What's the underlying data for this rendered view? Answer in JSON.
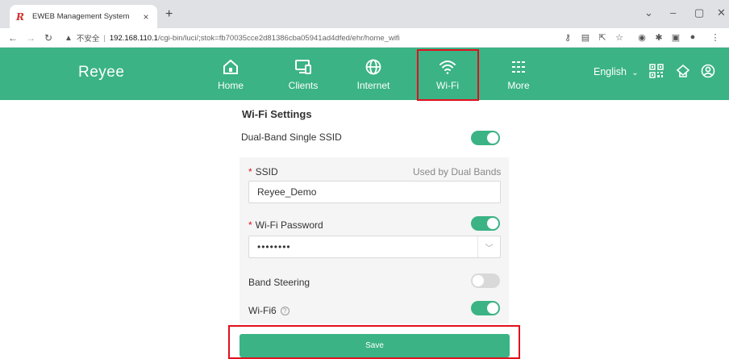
{
  "browser": {
    "tab_title": "EWEB Management System",
    "tab_favicon": "R",
    "tab_close": "×",
    "new_tab": "+",
    "address_not_secure": "不安全",
    "address_host": "192.168.110.1",
    "address_path": "/cgi-bin/luci/;stok=fb70035cce2d81386cba05941ad4dfed/ehr/home_wifi"
  },
  "header": {
    "logo": "Reyee",
    "nav": [
      {
        "label": "Home",
        "icon": "home-icon"
      },
      {
        "label": "Clients",
        "icon": "clients-icon"
      },
      {
        "label": "Internet",
        "icon": "globe-icon"
      },
      {
        "label": "Wi-Fi",
        "icon": "wifi-icon"
      },
      {
        "label": "More",
        "icon": "more-icon"
      }
    ],
    "language": "English",
    "colors": {
      "brand": "#3bb385",
      "highlight": "#e0101e"
    }
  },
  "wifi_settings": {
    "title": "Wi-Fi Settings",
    "dual_band_label": "Dual-Band Single SSID",
    "dual_band_on": true,
    "ssid_label": "SSID",
    "ssid_hint": "Used by Dual Bands",
    "ssid_value": "Reyee_Demo",
    "password_label": "Wi-Fi Password",
    "password_on": true,
    "password_value": "••••••••",
    "band_steering_label": "Band Steering",
    "band_steering_on": false,
    "wifi6_label": "Wi-Fi6",
    "wifi6_on": true,
    "save_label": "Save"
  }
}
